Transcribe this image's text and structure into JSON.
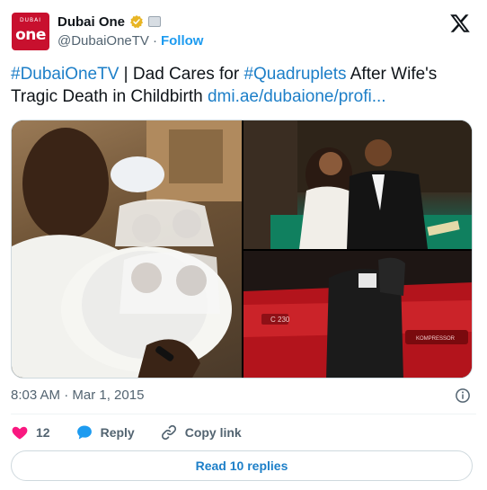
{
  "account": {
    "avatar_small_text": "DUBAI",
    "avatar_main_text": "one",
    "display_name": "Dubai One",
    "handle": "@DubaiOneTV",
    "separator": "·",
    "follow_label": "Follow"
  },
  "tweet": {
    "hashtag_1": "#DubaiOneTV",
    "text_1": " | Dad Cares for ",
    "hashtag_2": "#Quadruplets",
    "text_2": " After Wife's Tragic Death in Childbirth ",
    "link": "dmi.ae/dubaione/profi..."
  },
  "media": {
    "photos": [
      "father-holding-quadruplets",
      "couple-at-wedding",
      "woman-by-red-car"
    ],
    "car_plate_text": "C 230",
    "car_badge_text": "KOMPRESSOR"
  },
  "meta": {
    "timestamp": "8:03 AM · Mar 1, 2015"
  },
  "actions": {
    "like_count": "12",
    "reply_label": "Reply",
    "copy_label": "Copy link"
  },
  "read_replies_label": "Read 10 replies",
  "colors": {
    "accent": "#1d9bf0",
    "link": "#1d7fc8",
    "heart": "#f91880",
    "brand_red": "#c8102e"
  },
  "icons": {
    "verified": "verified-gold-badge-icon",
    "affiliate": "affiliate-badge-icon",
    "logo": "x-logo-icon",
    "info": "info-icon",
    "like": "heart-icon",
    "reply": "reply-bubble-icon",
    "copy": "link-icon"
  }
}
